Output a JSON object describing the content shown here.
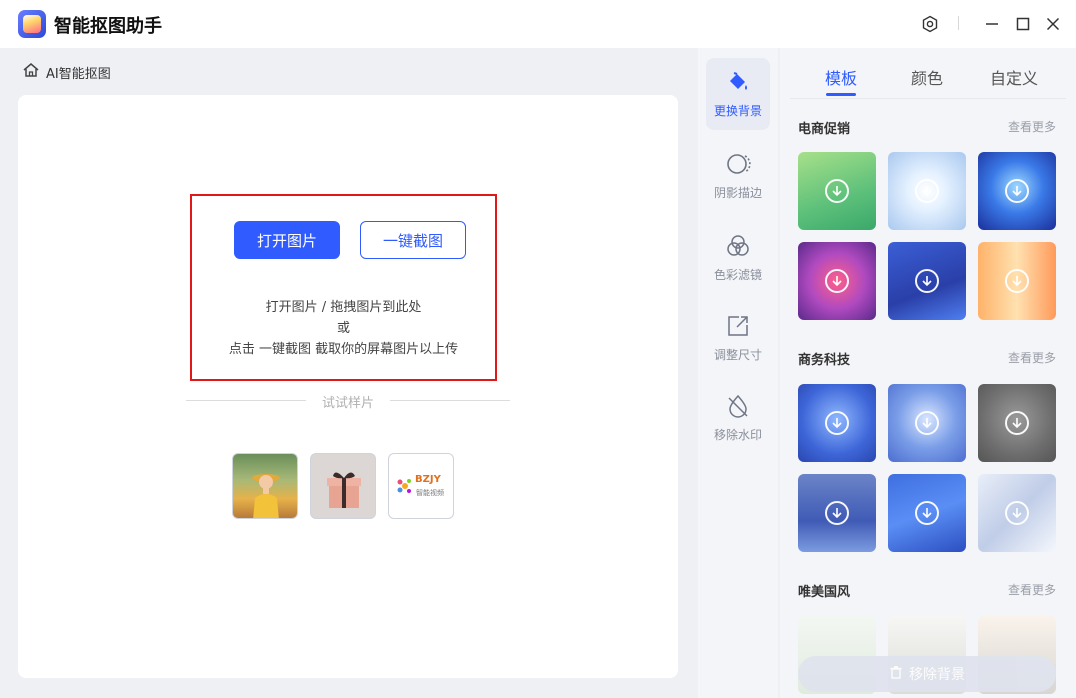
{
  "app": {
    "title": "智能抠图助手"
  },
  "breadcrumb": {
    "label": "AI智能抠图"
  },
  "workspace": {
    "open_button": "打开图片",
    "screenshot_button": "一键截图",
    "hint_line1": "打开图片 / 拖拽图片到此处",
    "hint_line2": "或",
    "hint_line3": "点击 一键截图 截取你的屏幕图片以上传",
    "samples_label": "试试样片",
    "sample_logo_text": "BZJY",
    "sample_logo_sub": "智能视频"
  },
  "tools": [
    {
      "label": "更换背景",
      "icon": "paint-bucket-icon",
      "active": true
    },
    {
      "label": "阴影描边",
      "icon": "shadow-outline-icon",
      "active": false
    },
    {
      "label": "色彩滤镜",
      "icon": "color-filter-icon",
      "active": false
    },
    {
      "label": "调整尺寸",
      "icon": "resize-icon",
      "active": false
    },
    {
      "label": "移除水印",
      "icon": "remove-watermark-icon",
      "active": false
    }
  ],
  "panel": {
    "tabs": [
      {
        "label": "模板",
        "active": true
      },
      {
        "label": "颜色",
        "active": false
      },
      {
        "label": "自定义",
        "active": false
      }
    ],
    "sections": [
      {
        "title": "电商促销",
        "more": "查看更多"
      },
      {
        "title": "商务科技",
        "more": "查看更多"
      },
      {
        "title": "唯美国风",
        "more": "查看更多"
      }
    ],
    "remove_button": "移除背景"
  },
  "colors": {
    "accent": "#2f5bff",
    "highlight_border": "#e01818"
  }
}
